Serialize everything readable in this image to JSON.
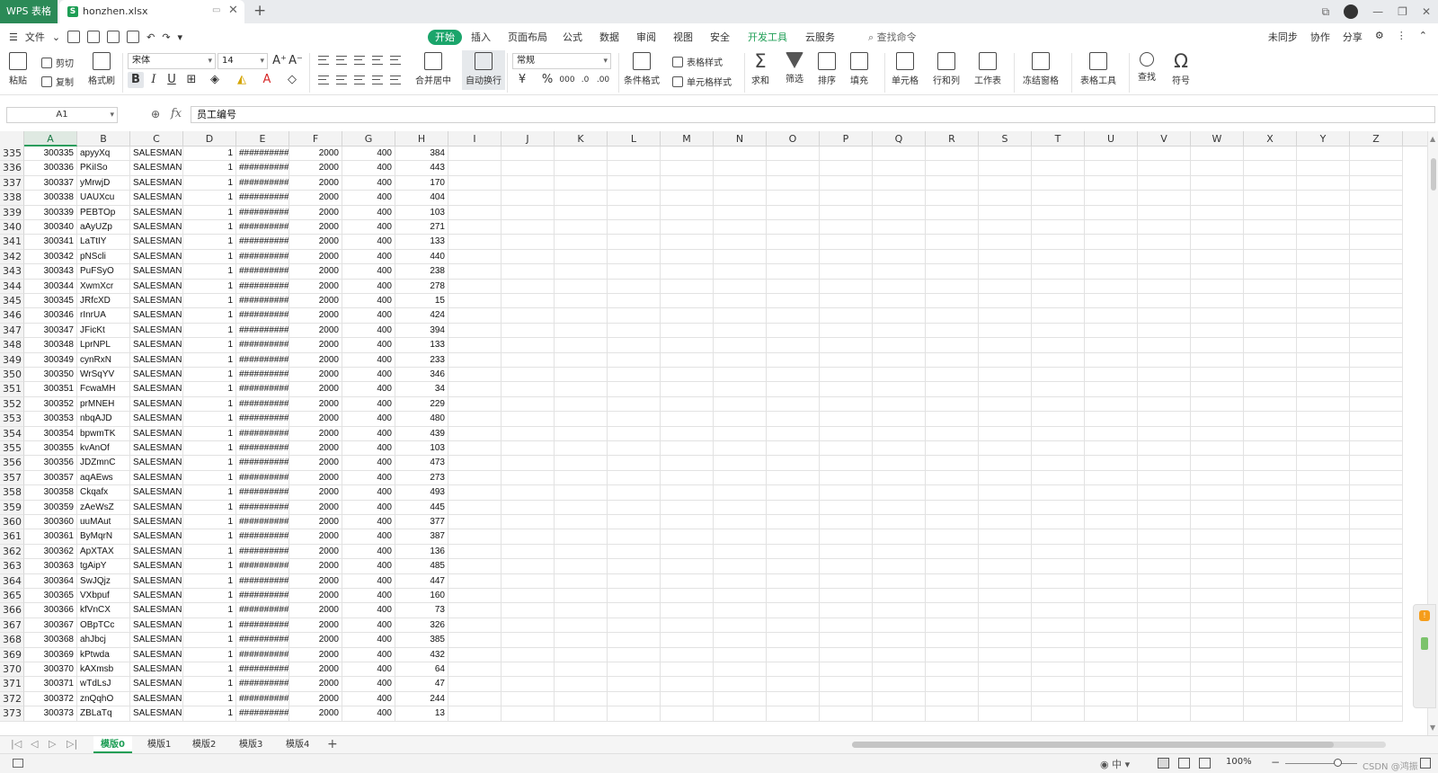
{
  "titlebar": {
    "app_name": "WPS 表格",
    "file_name": "honzhen.xlsx",
    "file_icon_letter": "S",
    "new_tab": "+"
  },
  "menubar": {
    "file_menu": "文件",
    "tabs": [
      "开始",
      "插入",
      "页面布局",
      "公式",
      "数据",
      "审阅",
      "视图",
      "安全",
      "开发工具",
      "云服务"
    ],
    "active_tab": "开始",
    "search_placeholder": "查找命令",
    "right_items": [
      "未同步",
      "协作",
      "分享"
    ]
  },
  "ribbon": {
    "paste": "粘贴",
    "cut": "剪切",
    "copy": "复制",
    "format_painter": "格式刷",
    "font_name": "宋体",
    "font_size": "14",
    "merge_center": "合并居中",
    "wrap_text": "自动换行",
    "number_format": "常规",
    "conditional_format": "条件格式",
    "table_style": "表格样式",
    "cell_style": "单元格样式",
    "sum": "求和",
    "filter": "筛选",
    "sort": "排序",
    "fill": "填充",
    "cell": "单元格",
    "row_col": "行和列",
    "worksheet": "工作表",
    "freeze_panes": "冻结窗格",
    "table_tools": "表格工具",
    "find": "查找",
    "symbol": "符号"
  },
  "formula_bar": {
    "cell_ref": "A1",
    "fx_label": "fx",
    "content": "员工编号"
  },
  "columns": [
    "A",
    "B",
    "C",
    "D",
    "E",
    "F",
    "G",
    "H",
    "I",
    "J",
    "K",
    "L",
    "M",
    "N",
    "O",
    "P",
    "Q",
    "R",
    "S",
    "T",
    "U",
    "V",
    "W",
    "X",
    "Y",
    "Z"
  ],
  "selected_column": "A",
  "rows": [
    {
      "n": "335",
      "a": "300335",
      "b": "apyyXq",
      "c": "SALESMAN",
      "d": "1",
      "e": "##########",
      "f": "2000",
      "g": "400",
      "h": "384"
    },
    {
      "n": "336",
      "a": "300336",
      "b": "PKiISo",
      "c": "SALESMAN",
      "d": "1",
      "e": "##########",
      "f": "2000",
      "g": "400",
      "h": "443"
    },
    {
      "n": "337",
      "a": "300337",
      "b": "yMrwjD",
      "c": "SALESMAN",
      "d": "1",
      "e": "##########",
      "f": "2000",
      "g": "400",
      "h": "170"
    },
    {
      "n": "338",
      "a": "300338",
      "b": "UAUXcu",
      "c": "SALESMAN",
      "d": "1",
      "e": "##########",
      "f": "2000",
      "g": "400",
      "h": "404"
    },
    {
      "n": "339",
      "a": "300339",
      "b": "PEBTOp",
      "c": "SALESMAN",
      "d": "1",
      "e": "##########",
      "f": "2000",
      "g": "400",
      "h": "103"
    },
    {
      "n": "340",
      "a": "300340",
      "b": "aAyUZp",
      "c": "SALESMAN",
      "d": "1",
      "e": "##########",
      "f": "2000",
      "g": "400",
      "h": "271"
    },
    {
      "n": "341",
      "a": "300341",
      "b": "LaTtIY",
      "c": "SALESMAN",
      "d": "1",
      "e": "##########",
      "f": "2000",
      "g": "400",
      "h": "133"
    },
    {
      "n": "342",
      "a": "300342",
      "b": "pNScli",
      "c": "SALESMAN",
      "d": "1",
      "e": "##########",
      "f": "2000",
      "g": "400",
      "h": "440"
    },
    {
      "n": "343",
      "a": "300343",
      "b": "PuFSyO",
      "c": "SALESMAN",
      "d": "1",
      "e": "##########",
      "f": "2000",
      "g": "400",
      "h": "238"
    },
    {
      "n": "344",
      "a": "300344",
      "b": "XwmXcr",
      "c": "SALESMAN",
      "d": "1",
      "e": "##########",
      "f": "2000",
      "g": "400",
      "h": "278"
    },
    {
      "n": "345",
      "a": "300345",
      "b": "JRfcXD",
      "c": "SALESMAN",
      "d": "1",
      "e": "##########",
      "f": "2000",
      "g": "400",
      "h": "15"
    },
    {
      "n": "346",
      "a": "300346",
      "b": "rInrUA",
      "c": "SALESMAN",
      "d": "1",
      "e": "##########",
      "f": "2000",
      "g": "400",
      "h": "424"
    },
    {
      "n": "347",
      "a": "300347",
      "b": "JFicKt",
      "c": "SALESMAN",
      "d": "1",
      "e": "##########",
      "f": "2000",
      "g": "400",
      "h": "394"
    },
    {
      "n": "348",
      "a": "300348",
      "b": "LprNPL",
      "c": "SALESMAN",
      "d": "1",
      "e": "##########",
      "f": "2000",
      "g": "400",
      "h": "133"
    },
    {
      "n": "349",
      "a": "300349",
      "b": "cynRxN",
      "c": "SALESMAN",
      "d": "1",
      "e": "##########",
      "f": "2000",
      "g": "400",
      "h": "233"
    },
    {
      "n": "350",
      "a": "300350",
      "b": "WrSqYV",
      "c": "SALESMAN",
      "d": "1",
      "e": "##########",
      "f": "2000",
      "g": "400",
      "h": "346"
    },
    {
      "n": "351",
      "a": "300351",
      "b": "FcwaMH",
      "c": "SALESMAN",
      "d": "1",
      "e": "##########",
      "f": "2000",
      "g": "400",
      "h": "34"
    },
    {
      "n": "352",
      "a": "300352",
      "b": "prMNEH",
      "c": "SALESMAN",
      "d": "1",
      "e": "##########",
      "f": "2000",
      "g": "400",
      "h": "229"
    },
    {
      "n": "353",
      "a": "300353",
      "b": "nbqAJD",
      "c": "SALESMAN",
      "d": "1",
      "e": "##########",
      "f": "2000",
      "g": "400",
      "h": "480"
    },
    {
      "n": "354",
      "a": "300354",
      "b": "bpwmTK",
      "c": "SALESMAN",
      "d": "1",
      "e": "##########",
      "f": "2000",
      "g": "400",
      "h": "439"
    },
    {
      "n": "355",
      "a": "300355",
      "b": "kvAnOf",
      "c": "SALESMAN",
      "d": "1",
      "e": "##########",
      "f": "2000",
      "g": "400",
      "h": "103"
    },
    {
      "n": "356",
      "a": "300356",
      "b": "JDZmnC",
      "c": "SALESMAN",
      "d": "1",
      "e": "##########",
      "f": "2000",
      "g": "400",
      "h": "473"
    },
    {
      "n": "357",
      "a": "300357",
      "b": "aqAEws",
      "c": "SALESMAN",
      "d": "1",
      "e": "##########",
      "f": "2000",
      "g": "400",
      "h": "273"
    },
    {
      "n": "358",
      "a": "300358",
      "b": "Ckqafx",
      "c": "SALESMAN",
      "d": "1",
      "e": "##########",
      "f": "2000",
      "g": "400",
      "h": "493"
    },
    {
      "n": "359",
      "a": "300359",
      "b": "zAeWsZ",
      "c": "SALESMAN",
      "d": "1",
      "e": "##########",
      "f": "2000",
      "g": "400",
      "h": "445"
    },
    {
      "n": "360",
      "a": "300360",
      "b": "uuMAut",
      "c": "SALESMAN",
      "d": "1",
      "e": "##########",
      "f": "2000",
      "g": "400",
      "h": "377"
    },
    {
      "n": "361",
      "a": "300361",
      "b": "ByMqrN",
      "c": "SALESMAN",
      "d": "1",
      "e": "##########",
      "f": "2000",
      "g": "400",
      "h": "387"
    },
    {
      "n": "362",
      "a": "300362",
      "b": "ApXTAX",
      "c": "SALESMAN",
      "d": "1",
      "e": "##########",
      "f": "2000",
      "g": "400",
      "h": "136"
    },
    {
      "n": "363",
      "a": "300363",
      "b": "tgAipY",
      "c": "SALESMAN",
      "d": "1",
      "e": "##########",
      "f": "2000",
      "g": "400",
      "h": "485"
    },
    {
      "n": "364",
      "a": "300364",
      "b": "SwJQjz",
      "c": "SALESMAN",
      "d": "1",
      "e": "##########",
      "f": "2000",
      "g": "400",
      "h": "447"
    },
    {
      "n": "365",
      "a": "300365",
      "b": "VXbpuf",
      "c": "SALESMAN",
      "d": "1",
      "e": "##########",
      "f": "2000",
      "g": "400",
      "h": "160"
    },
    {
      "n": "366",
      "a": "300366",
      "b": "kfVnCX",
      "c": "SALESMAN",
      "d": "1",
      "e": "##########",
      "f": "2000",
      "g": "400",
      "h": "73"
    },
    {
      "n": "367",
      "a": "300367",
      "b": "OBpTCc",
      "c": "SALESMAN",
      "d": "1",
      "e": "##########",
      "f": "2000",
      "g": "400",
      "h": "326"
    },
    {
      "n": "368",
      "a": "300368",
      "b": "ahJbcj",
      "c": "SALESMAN",
      "d": "1",
      "e": "##########",
      "f": "2000",
      "g": "400",
      "h": "385"
    },
    {
      "n": "369",
      "a": "300369",
      "b": "kPtwda",
      "c": "SALESMAN",
      "d": "1",
      "e": "##########",
      "f": "2000",
      "g": "400",
      "h": "432"
    },
    {
      "n": "370",
      "a": "300370",
      "b": "kAXmsb",
      "c": "SALESMAN",
      "d": "1",
      "e": "##########",
      "f": "2000",
      "g": "400",
      "h": "64"
    },
    {
      "n": "371",
      "a": "300371",
      "b": "wTdLsJ",
      "c": "SALESMAN",
      "d": "1",
      "e": "##########",
      "f": "2000",
      "g": "400",
      "h": "47"
    },
    {
      "n": "372",
      "a": "300372",
      "b": "znQqhO",
      "c": "SALESMAN",
      "d": "1",
      "e": "##########",
      "f": "2000",
      "g": "400",
      "h": "244"
    },
    {
      "n": "373",
      "a": "300373",
      "b": "ZBLaTq",
      "c": "SALESMAN",
      "d": "1",
      "e": "##########",
      "f": "2000",
      "g": "400",
      "h": "13"
    }
  ],
  "sheets": [
    "模版0",
    "模版1",
    "模版2",
    "模版3",
    "模版4"
  ],
  "active_sheet": "模版0",
  "statusbar": {
    "zoom": "100%",
    "watermark": "CSDN @鸿振"
  },
  "colors": {
    "accent": "#1ba56b",
    "app_tab": "#2b8a57",
    "selected_col_header": "#dfe9e2"
  }
}
